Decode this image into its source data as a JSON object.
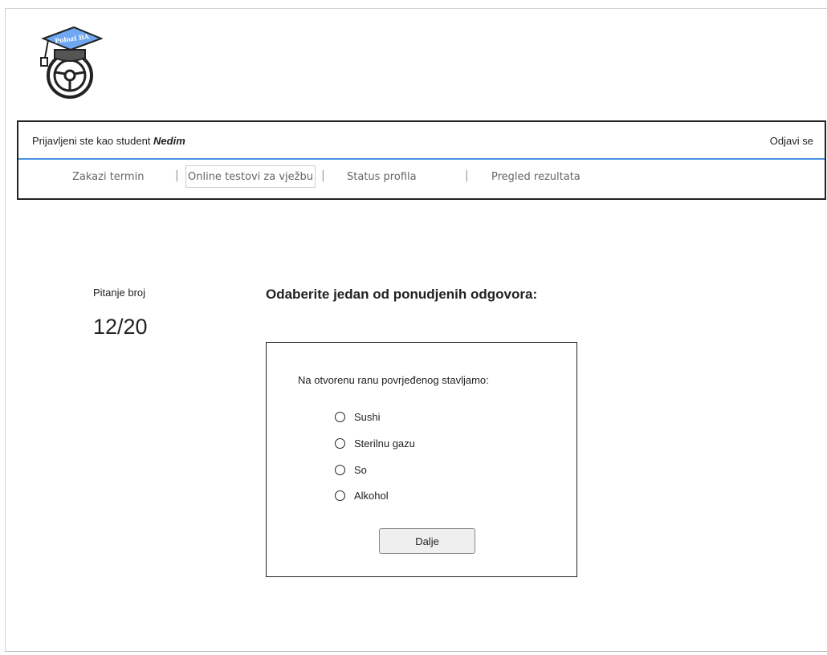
{
  "logo": {
    "text": "Polozi BA"
  },
  "header": {
    "login_prefix": "Prijavljeni ste kao student",
    "user_name": "Nedim",
    "logout_label": "Odjavi se"
  },
  "menu": {
    "items": [
      {
        "label": "Zakazi termin"
      },
      {
        "label": "Online testovi za vježbu",
        "active": true
      },
      {
        "label": "Status profila"
      },
      {
        "label": "Pregled rezultata"
      }
    ],
    "separator": "|"
  },
  "quiz": {
    "question_label": "Pitanje broj",
    "question_counter": "12/20",
    "instruction": "Odaberite jedan od ponudjenih odgovora:",
    "question_text": "Na otvorenu ranu povrjeđenog stavljamo:",
    "options": [
      {
        "label": "Sushi"
      },
      {
        "label": "Sterilnu gazu"
      },
      {
        "label": "So"
      },
      {
        "label": "Alkohol"
      }
    ],
    "next_label": "Dalje"
  }
}
